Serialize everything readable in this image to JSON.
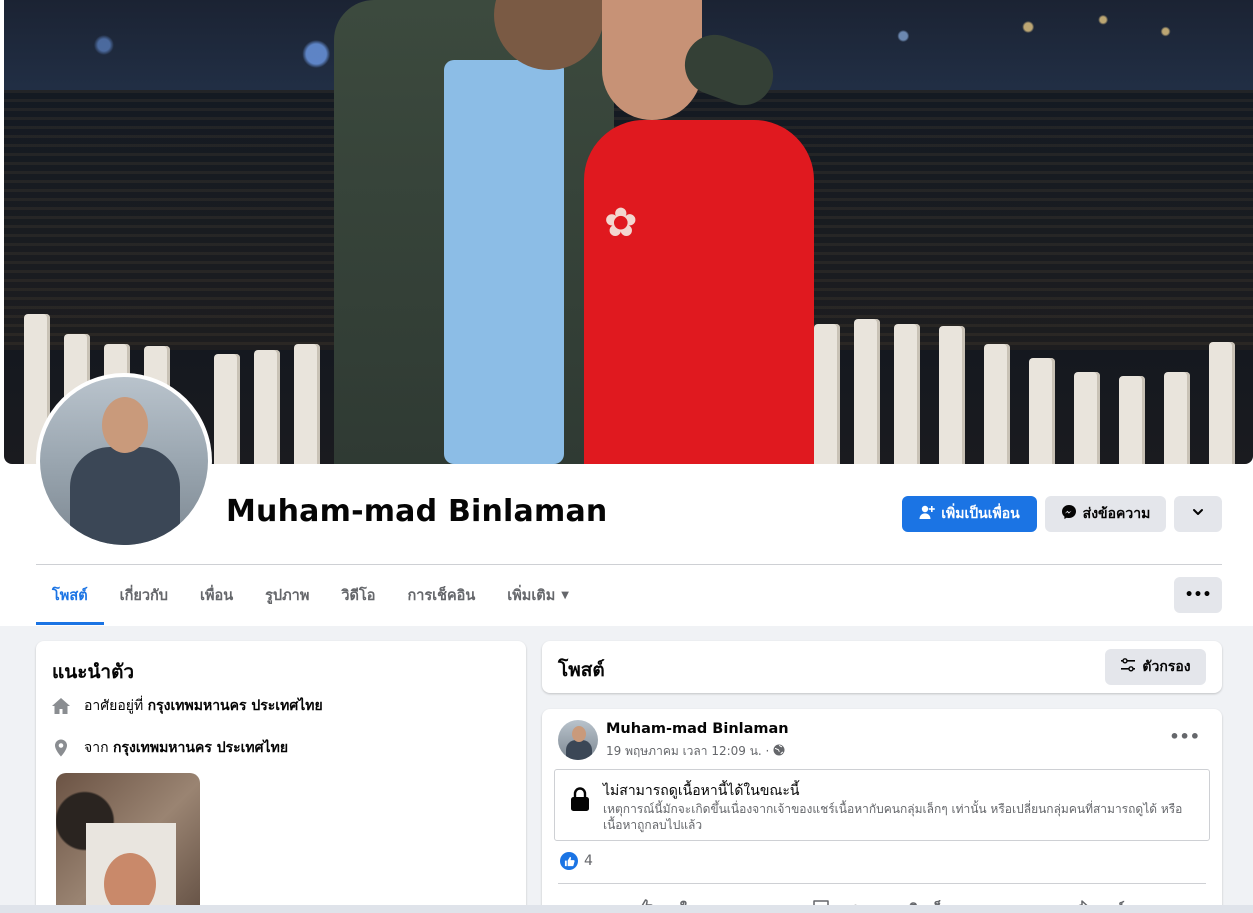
{
  "profile": {
    "name": "Muham-mad Binlaman"
  },
  "actions": {
    "add_friend": "เพิ่มเป็นเพื่อน",
    "message": "ส่งข้อความ"
  },
  "tabs": [
    {
      "label": "โพสต์",
      "active": true
    },
    {
      "label": "เกี่ยวกับ",
      "active": false
    },
    {
      "label": "เพื่อน",
      "active": false
    },
    {
      "label": "รูปภาพ",
      "active": false
    },
    {
      "label": "วิดีโอ",
      "active": false
    },
    {
      "label": "การเช็คอิน",
      "active": false
    },
    {
      "label": "เพิ่มเติม",
      "active": false
    }
  ],
  "intro": {
    "title": "แนะนำตัว",
    "lives_prefix": "อาศัยอยู่ที่",
    "lives_value": "กรุงเทพมหานคร ประเทศไทย",
    "from_prefix": "จาก",
    "from_value": "กรุงเทพมหานคร ประเทศไทย"
  },
  "posts_header": {
    "title": "โพสต์",
    "filter_label": "ตัวกรอง"
  },
  "post": {
    "author": "Muham-mad Binlaman",
    "timestamp": "19 พฤษภาคม เวลา 12:09 น. ·",
    "unavailable_title": "ไม่สามารถดูเนื้อหานี้ได้ในขณะนี้",
    "unavailable_desc": "เหตุการณ์นี้มักจะเกิดขึ้นเนื่องจากเจ้าของแชร์เนื้อหากับคนกลุ่มเล็กๆ เท่านั้น หรือเปลี่ยนกลุ่มคนที่สามารถดูได้ หรือเนื้อหาถูกลบไปแล้ว",
    "like_count": "4",
    "actions": {
      "like": "ถูกใจ",
      "comment": "แสดงความคิดเห็น",
      "share": "แชร์"
    }
  },
  "colors": {
    "brand_blue": "#1b74e4",
    "secondary_button": "#e4e6eb",
    "page_bg": "#f0f2f5"
  }
}
